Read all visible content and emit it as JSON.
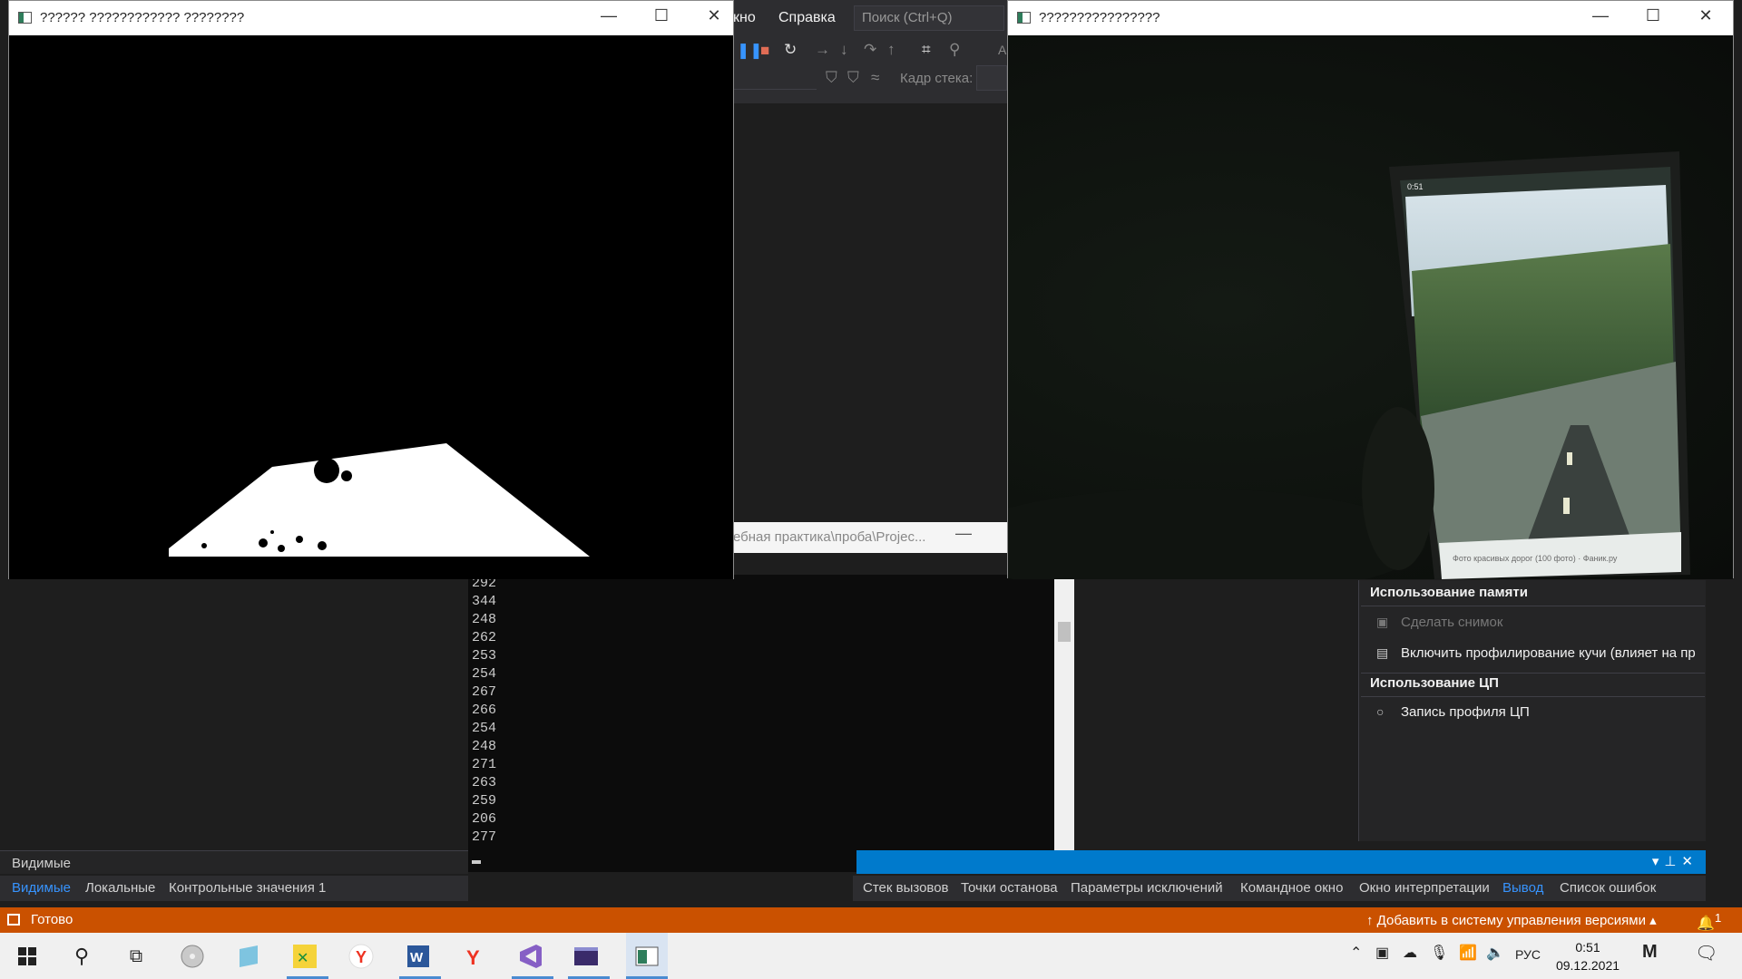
{
  "vs": {
    "menu": {
      "window_partial": "кно",
      "help": "Справка"
    },
    "search": {
      "placeholder": "Поиск (Ctrl+Q)"
    },
    "toolbar": {
      "frame_label": "Кадр стека:",
      "a_partial": "A"
    },
    "path_text": "ебная практика\\проба\\Projec...",
    "console": {
      "lines": [
        "292",
        "344",
        "248",
        "262",
        "253",
        "254",
        "267",
        "266",
        "254",
        "248",
        "271",
        "263",
        "259",
        "206",
        "277"
      ]
    },
    "left_panel_title": "Видимые",
    "bottom_tabs_left": [
      "Видимые",
      "Локальные",
      "Контрольные значения 1"
    ],
    "bottom_tabs_right": [
      "Стек вызовов",
      "Точки останова",
      "Параметры исключений",
      "Командное окно",
      "Окно интерпретации",
      "Вывод",
      "Список ошибок"
    ],
    "diagnostics": {
      "memory_header": "Использование памяти",
      "snapshot": "Сделать снимок",
      "heap": "Включить профилирование кучи (влияет на пр",
      "cpu_header": "Использование ЦП",
      "cpu_record": "Запись профиля ЦП"
    },
    "status": {
      "ready": "Готово",
      "vcs": "Добавить в систему управления версиями",
      "notifications": "1"
    }
  },
  "windows": {
    "mask": {
      "title": "?????? ???????????? ????????"
    },
    "camera": {
      "title": "????????????????"
    }
  },
  "phone_caption": "Фото красивых дорог (100 фото) · Фаник.ру",
  "phone_time": "0:51",
  "taskbar": {
    "tray_lang": "РУС",
    "time": "0:51",
    "date": "09.12.2021"
  },
  "colors": {
    "statusbar": "#ca5100",
    "accent": "#007acc",
    "taskbar": "#f0f0f0"
  }
}
